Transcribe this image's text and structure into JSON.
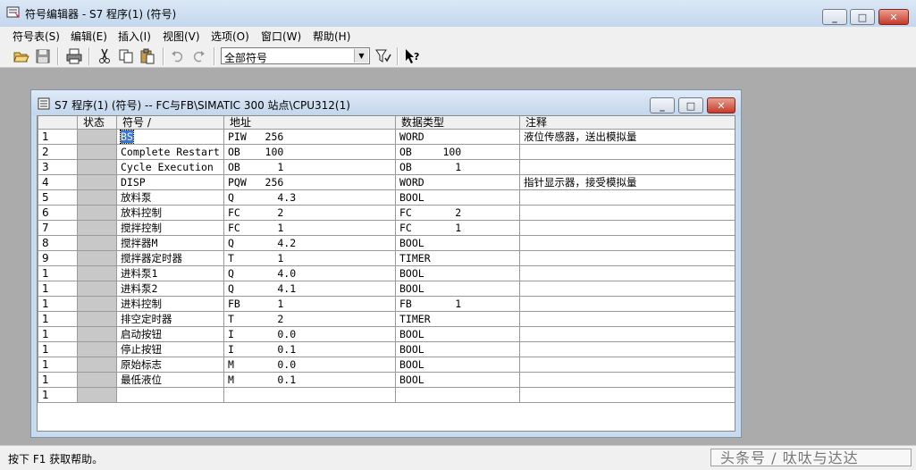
{
  "app": {
    "title": "符号编辑器 - S7 程序(1) (符号)",
    "caption_min": "_",
    "caption_max": "□",
    "caption_close": "✕"
  },
  "menu": [
    "符号表(S)",
    "编辑(E)",
    "插入(I)",
    "视图(V)",
    "选项(O)",
    "窗口(W)",
    "帮助(H)"
  ],
  "toolbar": {
    "filter_value": "全部符号",
    "icons": [
      "open-icon",
      "save-icon",
      "print-icon",
      "cut-icon",
      "copy-icon",
      "paste-icon",
      "undo-icon",
      "redo-icon",
      "filter-icon",
      "help-pointer-icon"
    ]
  },
  "child": {
    "title": "S7 程序(1) (符号) -- FC与FB\\SIMATIC 300 站点\\CPU312(1)"
  },
  "table": {
    "headers": [
      "",
      "状态",
      "符号  /",
      "地址",
      "数据类型",
      "注释"
    ],
    "rows": [
      {
        "n": "1",
        "sym": "BS",
        "addr": "PIW   256",
        "type": "WORD",
        "comment": "液位传感器，送出模拟量"
      },
      {
        "n": "2",
        "sym": "Complete Restart",
        "addr": "OB    100",
        "type": "OB     100",
        "comment": ""
      },
      {
        "n": "3",
        "sym": "Cycle Execution",
        "addr": "OB      1",
        "type": "OB       1",
        "comment": ""
      },
      {
        "n": "4",
        "sym": "DISP",
        "addr": "PQW   256",
        "type": "WORD",
        "comment": "指针显示器，接受模拟量"
      },
      {
        "n": "5",
        "sym": "放料泵",
        "addr": "Q       4.3",
        "type": "BOOL",
        "comment": ""
      },
      {
        "n": "6",
        "sym": "放料控制",
        "addr": "FC      2",
        "type": "FC       2",
        "comment": ""
      },
      {
        "n": "7",
        "sym": "搅拌控制",
        "addr": "FC      1",
        "type": "FC       1",
        "comment": ""
      },
      {
        "n": "8",
        "sym": "搅拌器M",
        "addr": "Q       4.2",
        "type": "BOOL",
        "comment": ""
      },
      {
        "n": "9",
        "sym": "搅拌器定时器",
        "addr": "T       1",
        "type": "TIMER",
        "comment": ""
      },
      {
        "n": "1",
        "sym": "进料泵1",
        "addr": "Q       4.0",
        "type": "BOOL",
        "comment": ""
      },
      {
        "n": "1",
        "sym": "进料泵2",
        "addr": "Q       4.1",
        "type": "BOOL",
        "comment": ""
      },
      {
        "n": "1",
        "sym": "进料控制",
        "addr": "FB      1",
        "type": "FB       1",
        "comment": ""
      },
      {
        "n": "1",
        "sym": "排空定时器",
        "addr": "T       2",
        "type": "TIMER",
        "comment": ""
      },
      {
        "n": "1",
        "sym": "启动按钮",
        "addr": "I       0.0",
        "type": "BOOL",
        "comment": ""
      },
      {
        "n": "1",
        "sym": "停止按钮",
        "addr": "I       0.1",
        "type": "BOOL",
        "comment": ""
      },
      {
        "n": "1",
        "sym": "原始标志",
        "addr": "M       0.0",
        "type": "BOOL",
        "comment": ""
      },
      {
        "n": "1",
        "sym": "最低液位",
        "addr": "M       0.1",
        "type": "BOOL",
        "comment": ""
      },
      {
        "n": "1",
        "sym": "",
        "addr": "",
        "type": "",
        "comment": ""
      }
    ]
  },
  "status": {
    "message": "按下 F1 获取帮助。",
    "watermark": "头条号 / 呔呔与达达"
  }
}
